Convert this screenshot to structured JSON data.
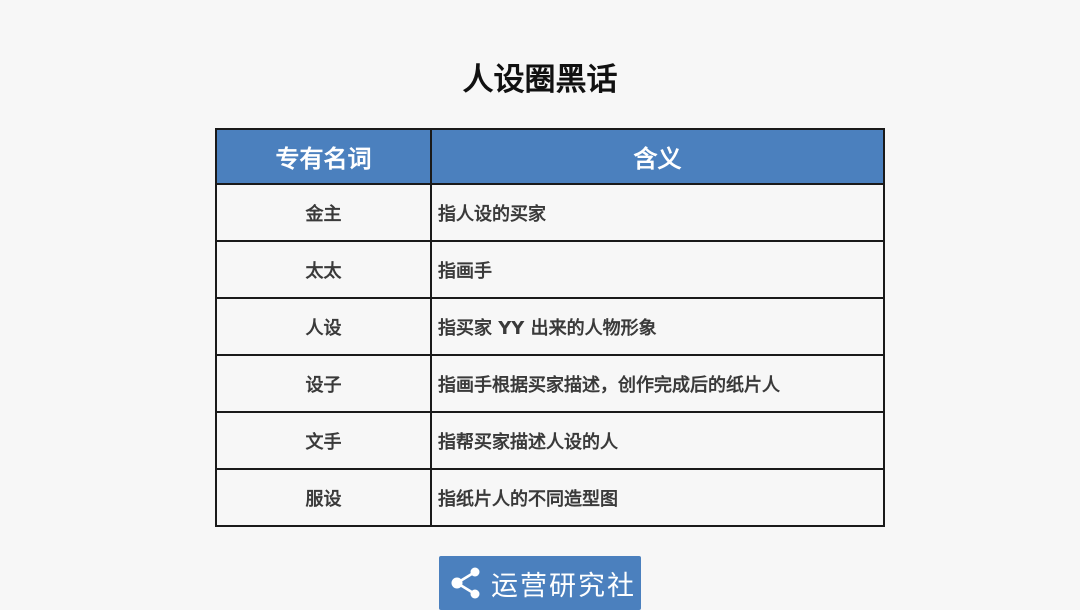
{
  "title": "人设圈黑话",
  "table": {
    "headers": [
      "专有名词",
      "含义"
    ],
    "rows": [
      {
        "term": "金主",
        "meaning": "指人设的买家"
      },
      {
        "term": "太太",
        "meaning": "指画手"
      },
      {
        "term": "人设",
        "meaning": "指买家 YY 出来的人物形象"
      },
      {
        "term": "设子",
        "meaning": "指画手根据买家描述，创作完成后的纸片人"
      },
      {
        "term": "文手",
        "meaning": "指帮买家描述人设的人"
      },
      {
        "term": "服设",
        "meaning": "指纸片人的不同造型图"
      }
    ]
  },
  "logo": {
    "text": "运营研究社",
    "icon": "share-icon",
    "background": "#4b80be"
  },
  "colors": {
    "header_bg": "#4b80be",
    "header_text": "#ffffff",
    "cell_text": "#3a3a3a",
    "border": "#1a1a1a"
  }
}
